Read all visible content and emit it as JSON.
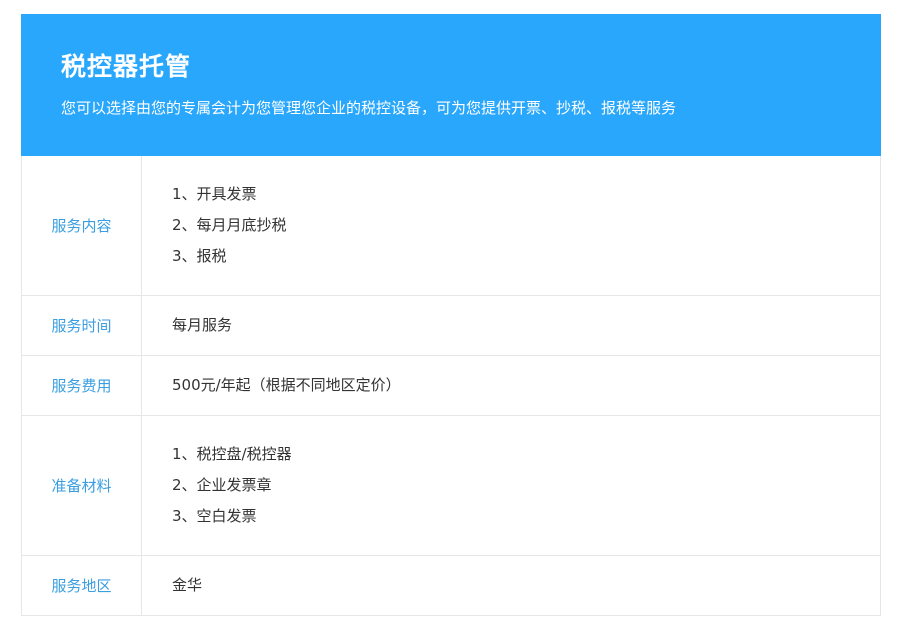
{
  "header": {
    "title": "税控器托管",
    "subtitle": "您可以选择由您的专属会计为您管理您企业的税控设备，可为您提供开票、抄税、报税等服务"
  },
  "rows": [
    {
      "label": "服务内容",
      "lines": [
        "1、开具发票",
        "2、每月月底抄税",
        "3、报税"
      ]
    },
    {
      "label": "服务时间",
      "lines": [
        "每月服务"
      ]
    },
    {
      "label": "服务费用",
      "lines": [
        "500元/年起（根据不同地区定价）"
      ]
    },
    {
      "label": "准备材料",
      "lines": [
        "1、税控盘/税控器",
        "2、企业发票章",
        "3、空白发票"
      ]
    },
    {
      "label": "服务地区",
      "lines": [
        "金华"
      ]
    }
  ],
  "colors": {
    "header_bg": "#29a7fc",
    "label_text": "#3a9ee0",
    "border": "#e6e6e6"
  }
}
